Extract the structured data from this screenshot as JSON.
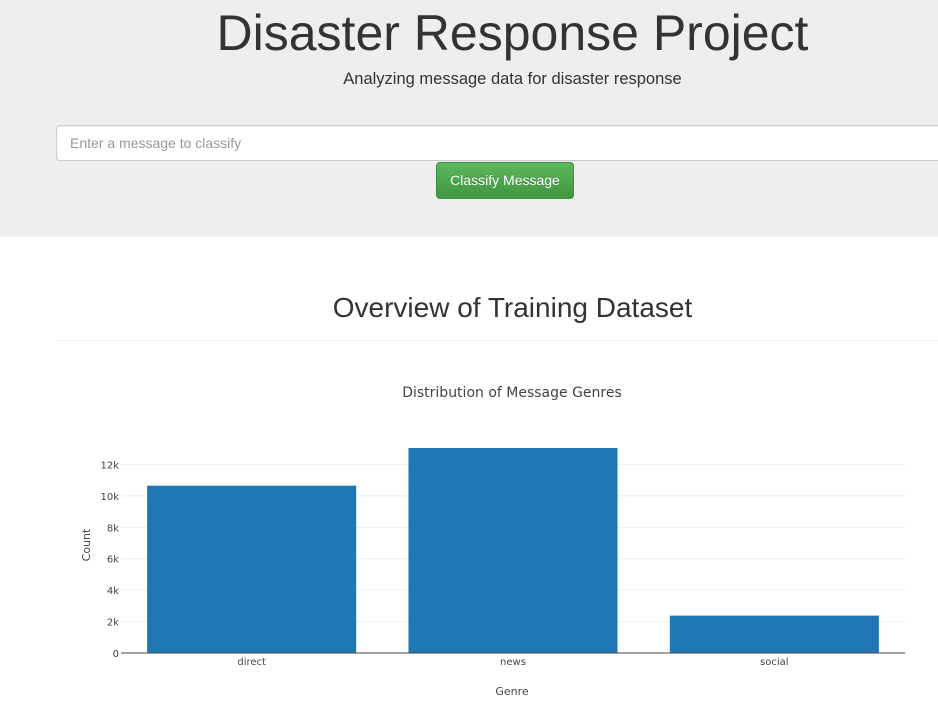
{
  "header": {
    "title": "Disaster Response Project",
    "subtitle": "Analyzing message data for disaster response"
  },
  "form": {
    "placeholder": "Enter a message to classify",
    "button_label": "Classify Message"
  },
  "section": {
    "title": "Overview of Training Dataset"
  },
  "colors": {
    "bar": "#1f77b4",
    "button": "#5cb85c",
    "jumbotron": "#eeeeee"
  },
  "chart_data": {
    "type": "bar",
    "title": "Distribution of Message Genres",
    "xlabel": "Genre",
    "ylabel": "Count",
    "categories": [
      "direct",
      "news",
      "social"
    ],
    "values": [
      10650,
      13050,
      2380
    ],
    "ylim": [
      0,
      13050
    ],
    "yticks": [
      0,
      2000,
      4000,
      6000,
      8000,
      10000,
      12000
    ],
    "ytick_labels": [
      "0",
      "2k",
      "4k",
      "6k",
      "8k",
      "10k",
      "12k"
    ],
    "grid": true
  }
}
